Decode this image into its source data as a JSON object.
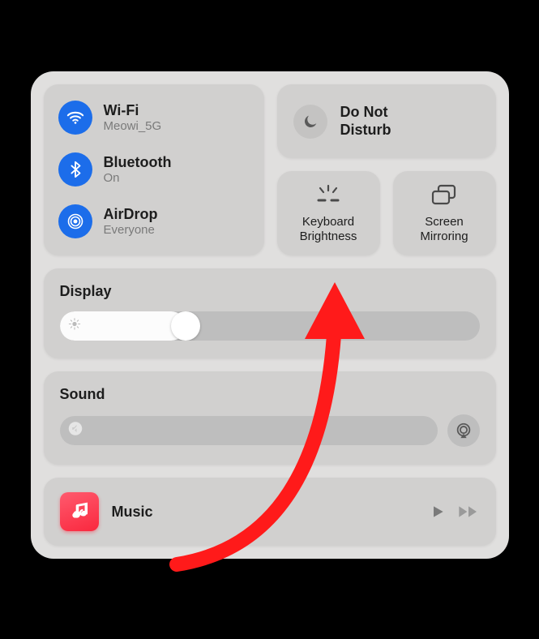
{
  "connectivity": {
    "wifi": {
      "title": "Wi-Fi",
      "subtitle": "Meowi_5G"
    },
    "bluetooth": {
      "title": "Bluetooth",
      "subtitle": "On"
    },
    "airdrop": {
      "title": "AirDrop",
      "subtitle": "Everyone"
    }
  },
  "dnd": {
    "label": "Do Not\nDisturb"
  },
  "keyboard_brightness": {
    "label": "Keyboard\nBrightness"
  },
  "screen_mirroring": {
    "label": "Screen\nMirroring"
  },
  "display": {
    "label": "Display",
    "value_percent": 30
  },
  "sound": {
    "label": "Sound",
    "value_percent": 0
  },
  "music": {
    "title": "Music"
  },
  "colors": {
    "accent_blue": "#1c6dea",
    "annotation_red": "#ff1a1a"
  }
}
